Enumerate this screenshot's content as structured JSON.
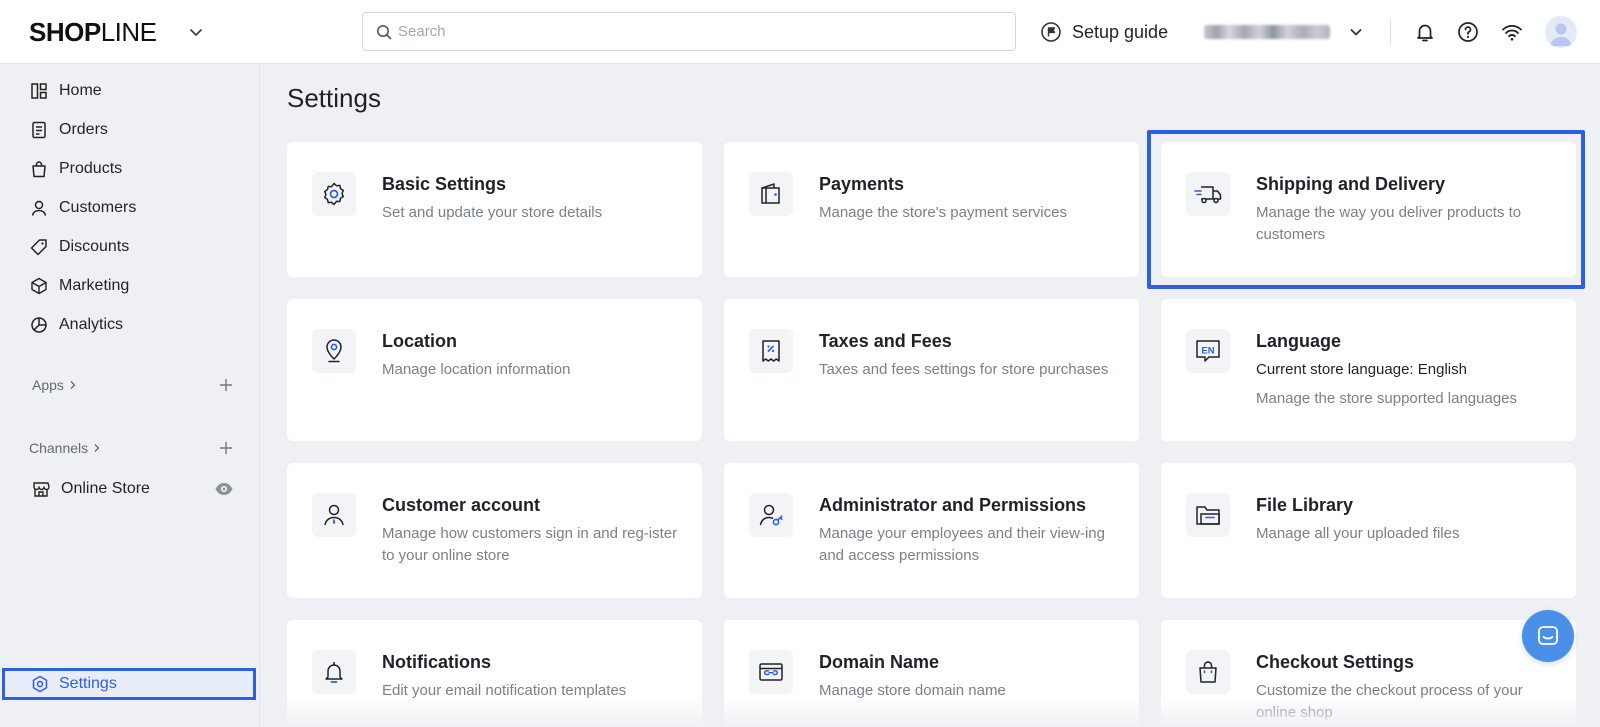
{
  "brand": {
    "logo_text_bold": "SHOP",
    "logo_text_thin": "LINE"
  },
  "header": {
    "search_placeholder": "Search",
    "setup_guide": "Setup guide"
  },
  "sidebar": {
    "items": [
      {
        "label": "Home",
        "icon": "home-icon"
      },
      {
        "label": "Orders",
        "icon": "orders-icon"
      },
      {
        "label": "Products",
        "icon": "products-icon"
      },
      {
        "label": "Customers",
        "icon": "customers-icon"
      },
      {
        "label": "Discounts",
        "icon": "discounts-icon"
      },
      {
        "label": "Marketing",
        "icon": "marketing-icon"
      },
      {
        "label": "Analytics",
        "icon": "analytics-icon"
      }
    ],
    "apps_label": "Apps",
    "channels_label": "Channels",
    "online_store": "Online Store",
    "settings": "Settings"
  },
  "main": {
    "title": "Settings",
    "cards": [
      {
        "title": "Basic Settings",
        "desc": "Set and update your store details",
        "icon": "gear-icon"
      },
      {
        "title": "Payments",
        "desc": "Manage the store's payment services",
        "icon": "wallet-icon"
      },
      {
        "title": "Shipping and Delivery",
        "desc": "Manage the way you deliver products to customers",
        "icon": "truck-icon"
      },
      {
        "title": "Location",
        "desc": "Manage location information",
        "icon": "location-pin-icon"
      },
      {
        "title": "Taxes and Fees",
        "desc": "Taxes and fees settings for store purchases",
        "icon": "receipt-icon"
      },
      {
        "title": "Language",
        "desc": "Current store language: English",
        "desc2": "Manage the store supported languages",
        "icon": "language-en-icon"
      },
      {
        "title": "Customer account",
        "desc": "Manage how customers sign in and reg-ister to your online store",
        "icon": "user-icon"
      },
      {
        "title": "Administrator and Permissions",
        "desc": "Manage your employees and their view-ing and access permissions",
        "icon": "admin-key-icon"
      },
      {
        "title": "File Library",
        "desc": "Manage all your uploaded files",
        "icon": "folder-icon"
      },
      {
        "title": "Notifications",
        "desc": "Edit your email notification templates",
        "icon": "bell-icon"
      },
      {
        "title": "Domain Name",
        "desc": "Manage store domain name",
        "icon": "domain-icon"
      },
      {
        "title": "Checkout Settings",
        "desc": "Customize the checkout process of your online shop",
        "icon": "shopping-bag-icon"
      }
    ]
  },
  "colors": {
    "accent": "#2b5fe4",
    "background": "#eef0f4",
    "chat": "#4a8fe8"
  }
}
